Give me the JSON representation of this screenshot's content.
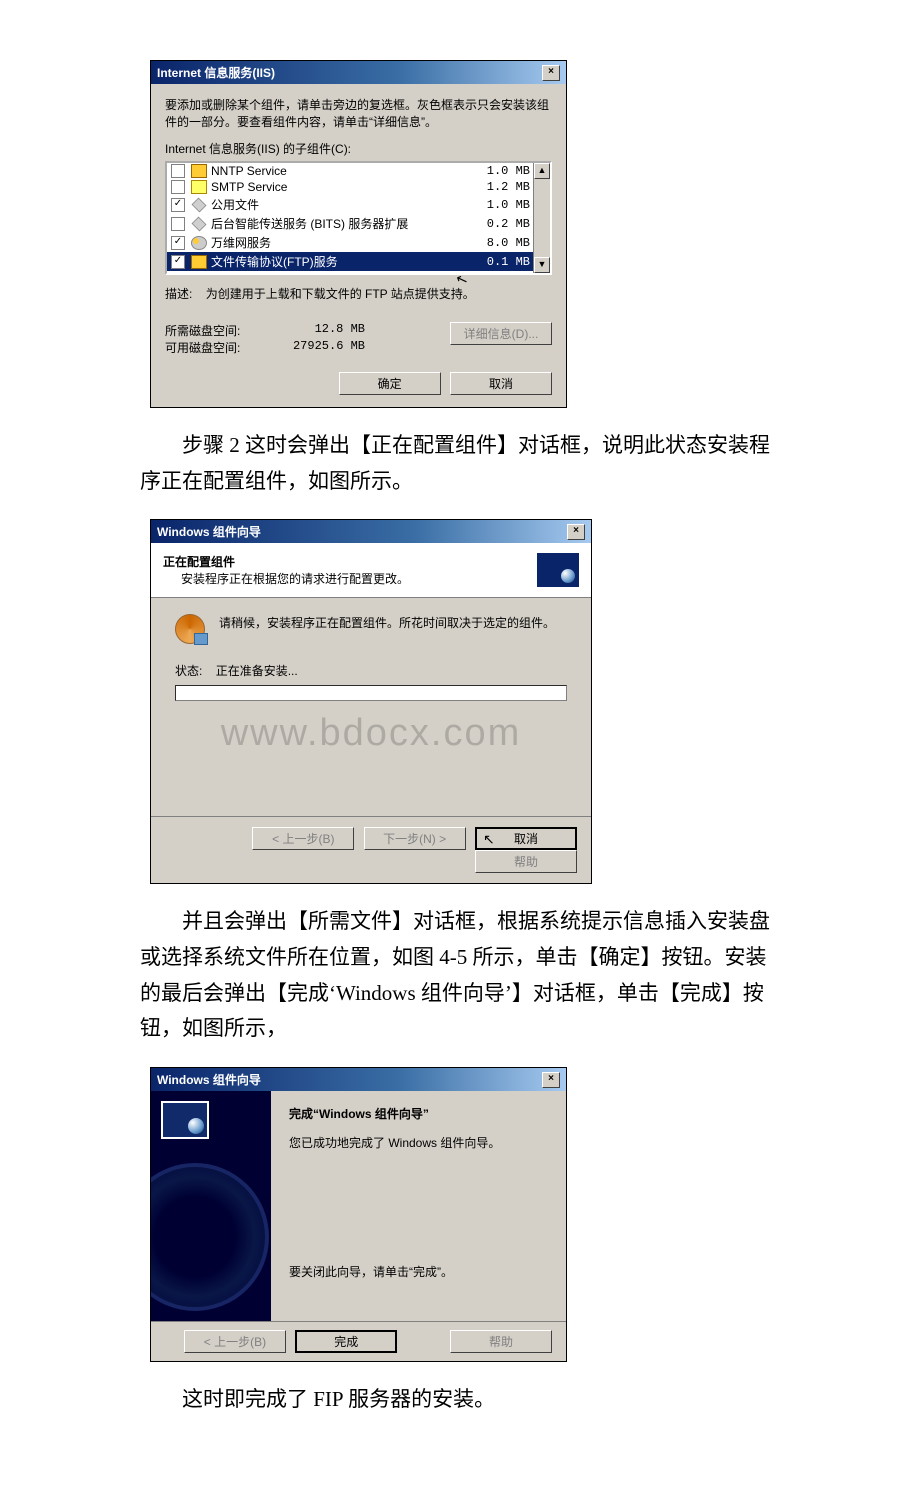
{
  "iis_dialog": {
    "title": "Internet 信息服务(IIS)",
    "close": "×",
    "hint": "要添加或删除某个组件，请单击旁边的复选框。灰色框表示只会安装该组件的一部分。要查看组件内容，请单击“详细信息”。",
    "sublabel": "Internet 信息服务(IIS) 的子组件(C):",
    "items": [
      {
        "checked": false,
        "name": "NNTP Service",
        "size": "1.0 MB",
        "iconClass": "icon-folder"
      },
      {
        "checked": false,
        "name": "SMTP Service",
        "size": "1.2 MB",
        "iconClass": "icon-env"
      },
      {
        "checked": true,
        "name": "公用文件",
        "size": "1.0 MB",
        "iconClass": "icon-diamond"
      },
      {
        "checked": false,
        "name": "后台智能传送服务 (BITS) 服务器扩展",
        "size": "0.2 MB",
        "iconClass": "icon-diamond"
      },
      {
        "checked": true,
        "name": "万维网服务",
        "size": "8.0 MB",
        "iconClass": "icon-globe"
      },
      {
        "checked": true,
        "name": "文件传输协议(FTP)服务",
        "size": "0.1 MB",
        "iconClass": "icon-yfolder",
        "selected": true
      }
    ],
    "desc_label": "描述:",
    "desc_text": "为创建用于上载和下载文件的 FTP 站点提供支持。",
    "space_needed_label": "所需磁盘空间:",
    "space_needed": "12.8 MB",
    "space_avail_label": "可用磁盘空间:",
    "space_avail": "27925.6 MB",
    "details_btn": "详细信息(D)...",
    "ok_btn": "确定",
    "cancel_btn": "取消"
  },
  "para1": "步骤 2 这时会弹出【正在配置组件】对话框，说明此状态安装程序正在配置组件，如图所示。",
  "wizard_dialog": {
    "title": "Windows 组件向导",
    "close": "×",
    "header_title": "正在配置组件",
    "header_sub": "安装程序正在根据您的请求进行配置更改。",
    "wait_text": "请稍候，安装程序正在配置组件。所花时间取决于选定的组件。",
    "status_label": "状态:",
    "status_value": "正在准备安装...",
    "back_btn": "< 上一步(B)",
    "next_btn": "下一步(N) >",
    "cancel_btn": "取消",
    "help_btn": "帮助",
    "watermark": "www.bdocx.com"
  },
  "para2": "并且会弹出【所需文件】对话框，根据系统提示信息插入安装盘或选择系统文件所在位置，如图 4-5 所示，单击【确定】按钮。安装的最后会弹出【完成‘Windows 组件向导’】对话框，单击【完成】按钮，如图所示，",
  "finish_dialog": {
    "title": "Windows 组件向导",
    "close": "×",
    "heading": "完成“Windows 组件向导”",
    "text1": "您已成功地完成了 Windows 组件向导。",
    "text2": "要关闭此向导，请单击“完成”。",
    "back_btn": "< 上一步(B)",
    "finish_btn": "完成",
    "help_btn": "帮助"
  },
  "para3": "这时即完成了 FIP 服务器的安装。"
}
